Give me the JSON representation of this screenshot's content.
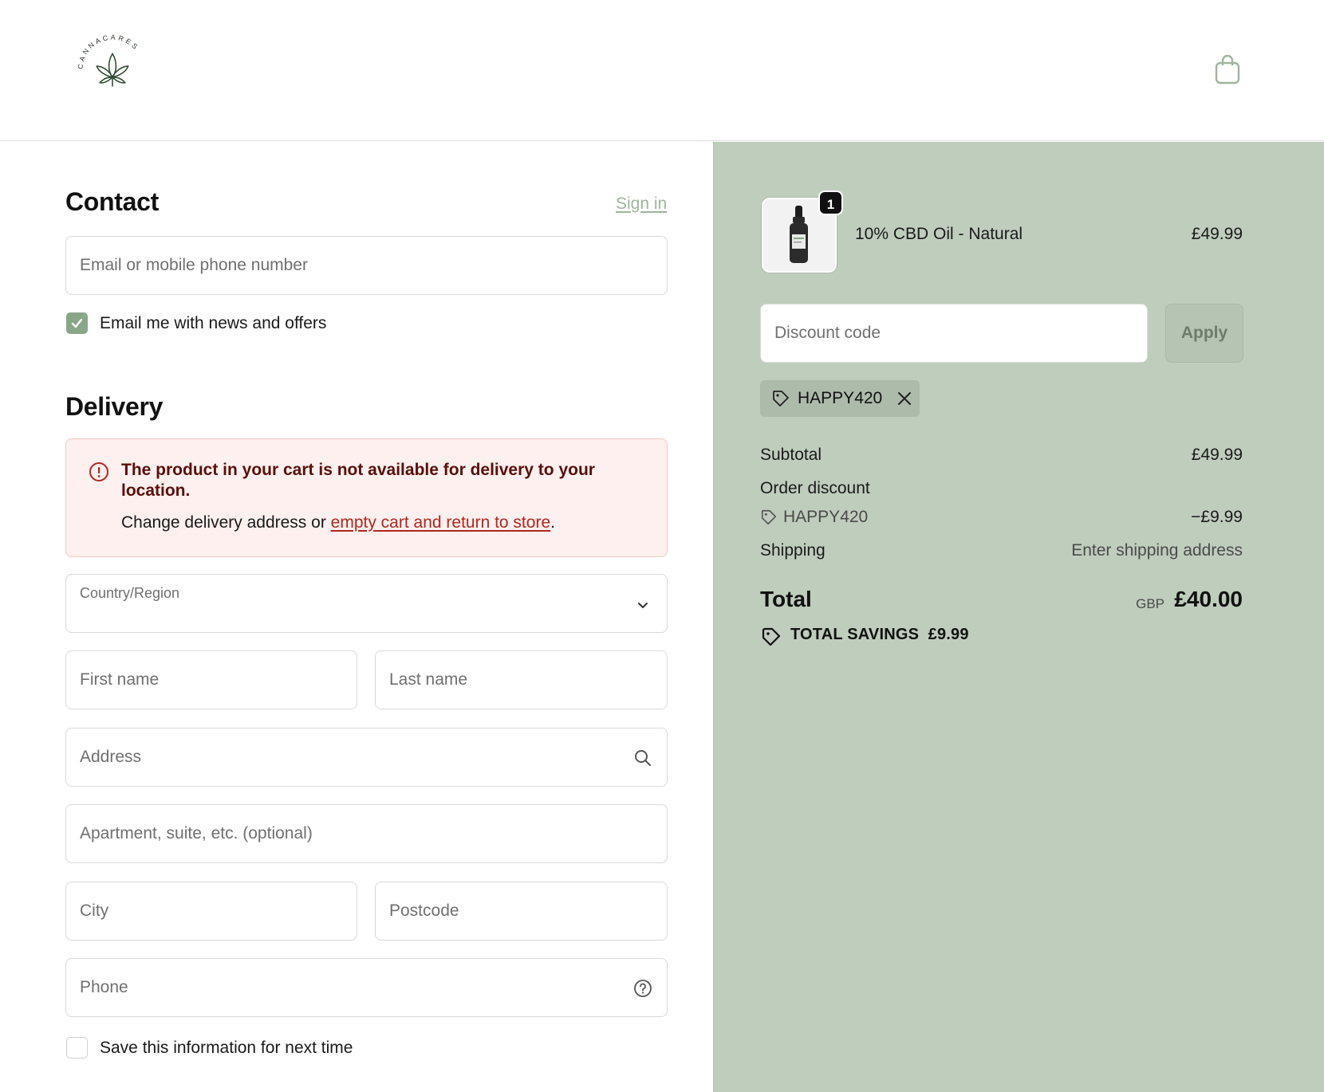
{
  "brand": {
    "logo_text": "CANNACARES",
    "accent": "#8aa688",
    "panel_bg": "#bfcdbd"
  },
  "header": {
    "cart_icon": "shopping-bag-icon"
  },
  "contact": {
    "title": "Contact",
    "sign_in": "Sign in",
    "email_placeholder": "Email or mobile phone number",
    "news_label": "Email me with news and offers",
    "news_checked": true
  },
  "delivery": {
    "title": "Delivery",
    "alert": {
      "title": "The product in your cart is not available for delivery to your location.",
      "body_prefix": "Change delivery address or ",
      "link": "empty cart and return to store",
      "body_suffix": "."
    },
    "country_label": "Country/Region",
    "first_name": "First name",
    "last_name": "Last name",
    "address": "Address",
    "apartment": "Apartment, suite, etc. (optional)",
    "city": "City",
    "postcode": "Postcode",
    "phone": "Phone",
    "save_label": "Save this information for next time",
    "save_checked": false
  },
  "summary": {
    "item": {
      "name": "10% CBD Oil - Natural",
      "price": "£49.99",
      "quantity": "1"
    },
    "discount_placeholder": "Discount code",
    "apply": "Apply",
    "applied_code": "HAPPY420",
    "subtotal_label": "Subtotal",
    "subtotal_value": "£49.99",
    "order_discount_label": "Order discount",
    "order_discount_code": "HAPPY420",
    "order_discount_value": "−£9.99",
    "shipping_label": "Shipping",
    "shipping_value": "Enter shipping address",
    "total_label": "Total",
    "currency": "GBP",
    "total_value": "£40.00",
    "savings_label": "TOTAL SAVINGS",
    "savings_value": "£9.99"
  }
}
